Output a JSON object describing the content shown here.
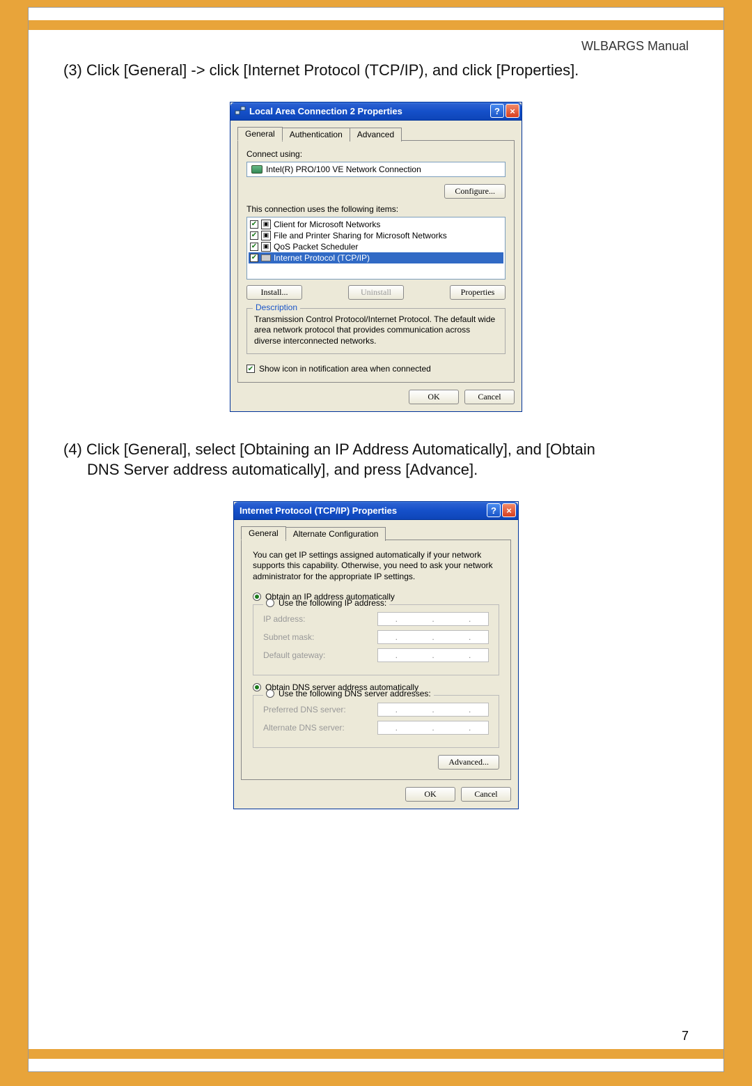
{
  "header": {
    "manual": "WLBARGS Manual"
  },
  "step3": "(3) Click [General] -> click [Internet Protocol (TCP/IP), and click [Properties].",
  "step4_line1": "(4) Click [General], select [Obtaining an IP Address Automatically], and [Obtain",
  "step4_line2": "DNS Server address automatically], and press [Advance].",
  "page_number": "7",
  "dialog1": {
    "title": "Local Area Connection 2 Properties",
    "tabs": [
      "General",
      "Authentication",
      "Advanced"
    ],
    "connect_using_label": "Connect using:",
    "adapter": "Intel(R) PRO/100 VE Network Connection",
    "configure": "Configure...",
    "uses_items_label": "This connection uses the following items:",
    "items": [
      "Client for Microsoft Networks",
      "File and Printer Sharing for Microsoft Networks",
      "QoS Packet Scheduler",
      "Internet Protocol (TCP/IP)"
    ],
    "install": "Install...",
    "uninstall": "Uninstall",
    "properties": "Properties",
    "desc_title": "Description",
    "desc_text": "Transmission Control Protocol/Internet Protocol. The default wide area network protocol that provides communication across diverse interconnected networks.",
    "show_icon": "Show icon in notification area when connected",
    "ok": "OK",
    "cancel": "Cancel"
  },
  "dialog2": {
    "title": "Internet Protocol (TCP/IP) Properties",
    "tabs": [
      "General",
      "Alternate Configuration"
    ],
    "helptext": "You can get IP settings assigned automatically if your network supports this capability. Otherwise, you need to ask your network administrator for the appropriate IP settings.",
    "rb_auto_ip": "Obtain an IP address automatically",
    "rb_manual_ip": "Use the following IP address:",
    "ip_address": "IP address:",
    "subnet": "Subnet mask:",
    "gateway": "Default gateway:",
    "rb_auto_dns": "Obtain DNS server address automatically",
    "rb_manual_dns": "Use the following DNS server addresses:",
    "pref_dns": "Preferred DNS server:",
    "alt_dns": "Alternate DNS server:",
    "advanced": "Advanced...",
    "ok": "OK",
    "cancel": "Cancel"
  }
}
